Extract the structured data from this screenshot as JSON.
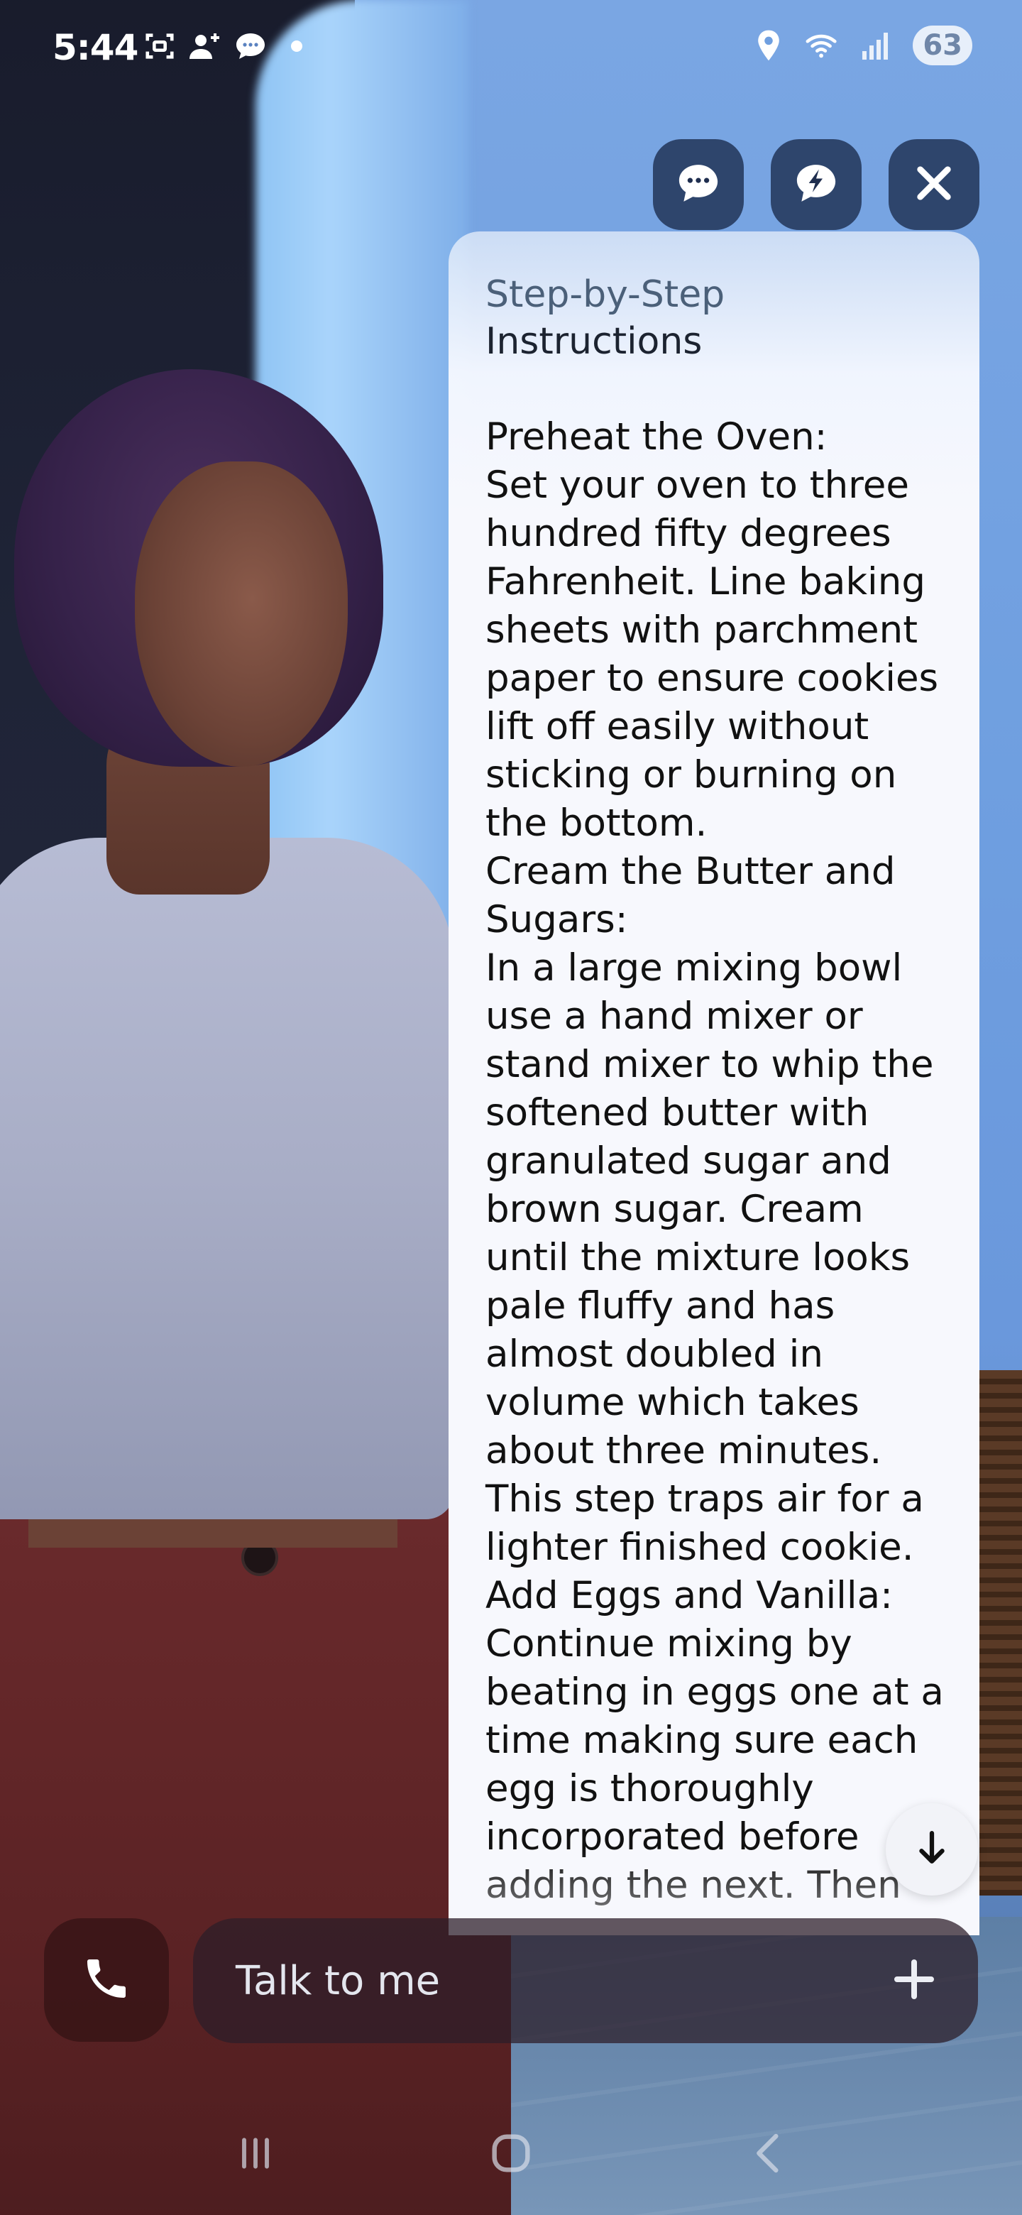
{
  "status_bar": {
    "time": "5:44",
    "battery": "63",
    "icons_left": [
      "screenshot-icon",
      "add-contact-icon",
      "message-icon",
      "notification-dot"
    ],
    "icons_right": [
      "location-icon",
      "wifi-icon",
      "signal-icon",
      "battery-icon"
    ]
  },
  "top_actions": {
    "chat_icon": "chat-bubble-icon",
    "quick_chat_icon": "lightning-bubble-icon",
    "close_icon": "close-icon"
  },
  "panel": {
    "title_line1": "Step-by-Step",
    "title_line2": "Instructions",
    "body": "Preheat the Oven:\nSet your oven to three hundred fifty degrees Fahrenheit. Line baking sheets with parchment paper to ensure cookies lift off easily without sticking or burning on the bottom.\nCream the Butter and Sugars:\nIn a large mixing bowl use a hand mixer or stand mixer to whip the softened butter with granulated sugar and brown sugar. Cream until the mixture looks pale fluffy and has almost doubled in volume which takes about three minutes. This step traps air for a lighter finished cookie.\nAdd Eggs and Vanilla:\nContinue mixing by beating in eggs one at a time making sure each egg is thoroughly incorporated before adding the next. Then"
  },
  "input_bar": {
    "placeholder": "Talk to me"
  },
  "nav": {
    "items": [
      "recent-apps",
      "home",
      "back"
    ]
  },
  "colors": {
    "panel_bg": "#f7f8fd",
    "button_bg": "#12203e",
    "input_bg": "#2c1e28"
  }
}
